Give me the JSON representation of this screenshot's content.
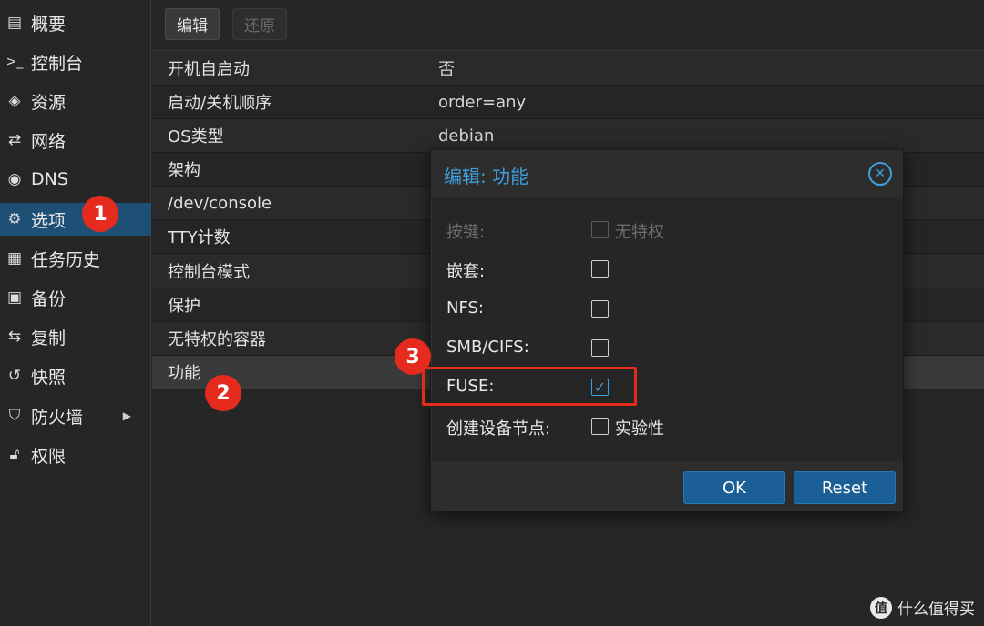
{
  "sidebar": {
    "items": [
      {
        "label": "概要",
        "icon": "book-icon",
        "glyph": "▤"
      },
      {
        "label": "控制台",
        "icon": "terminal-icon",
        "glyph": ">_"
      },
      {
        "label": "资源",
        "icon": "cube-icon",
        "glyph": "◈"
      },
      {
        "label": "网络",
        "icon": "exchange-icon",
        "glyph": "⇄"
      },
      {
        "label": "DNS",
        "icon": "globe-icon",
        "glyph": "◉"
      },
      {
        "label": "选项",
        "icon": "gear-icon",
        "glyph": "⚙"
      },
      {
        "label": "任务历史",
        "icon": "list-icon",
        "glyph": "▦"
      },
      {
        "label": "备份",
        "icon": "floppy-icon",
        "glyph": "▣"
      },
      {
        "label": "复制",
        "icon": "retweet-icon",
        "glyph": "⇆"
      },
      {
        "label": "快照",
        "icon": "history-icon",
        "glyph": "↺"
      },
      {
        "label": "防火墙",
        "icon": "shield-icon",
        "glyph": "⛉"
      },
      {
        "label": "权限",
        "icon": "unlock-icon",
        "glyph": "🔓︎"
      }
    ],
    "firewall_arrow": "▶"
  },
  "toolbar": {
    "edit_label": "编辑",
    "revert_label": "还原"
  },
  "properties": [
    {
      "key": "开机自启动",
      "value": "否"
    },
    {
      "key": "启动/关机顺序",
      "value": "order=any"
    },
    {
      "key": "OS类型",
      "value": "debian"
    },
    {
      "key": "架构",
      "value": ""
    },
    {
      "key": "/dev/console",
      "value": ""
    },
    {
      "key": "TTY计数",
      "value": ""
    },
    {
      "key": "控制台模式",
      "value": ""
    },
    {
      "key": "保护",
      "value": ""
    },
    {
      "key": "无特权的容器",
      "value": ""
    },
    {
      "key": "功能",
      "value": ""
    }
  ],
  "dialog": {
    "title": "编辑: 功能",
    "close_glyph": "✕",
    "fields": [
      {
        "label": "按键:",
        "checkbox_text": "无特权",
        "checked": false,
        "disabled": true
      },
      {
        "label": "嵌套:",
        "checkbox_text": "",
        "checked": false,
        "disabled": false
      },
      {
        "label": "NFS:",
        "checkbox_text": "",
        "checked": false,
        "disabled": false
      },
      {
        "label": "SMB/CIFS:",
        "checkbox_text": "",
        "checked": false,
        "disabled": false
      },
      {
        "label": "FUSE:",
        "checkbox_text": "",
        "checked": true,
        "disabled": false
      },
      {
        "label": "创建设备节点:",
        "checkbox_text": "实验性",
        "checked": false,
        "disabled": false
      }
    ],
    "check_glyph": "✓",
    "ok_label": "OK",
    "reset_label": "Reset"
  },
  "annotations": {
    "badge1": "1",
    "badge2": "2",
    "badge3": "3",
    "color": "#e52b1e"
  },
  "watermark": {
    "logo": "值",
    "text": "什么值得买"
  }
}
